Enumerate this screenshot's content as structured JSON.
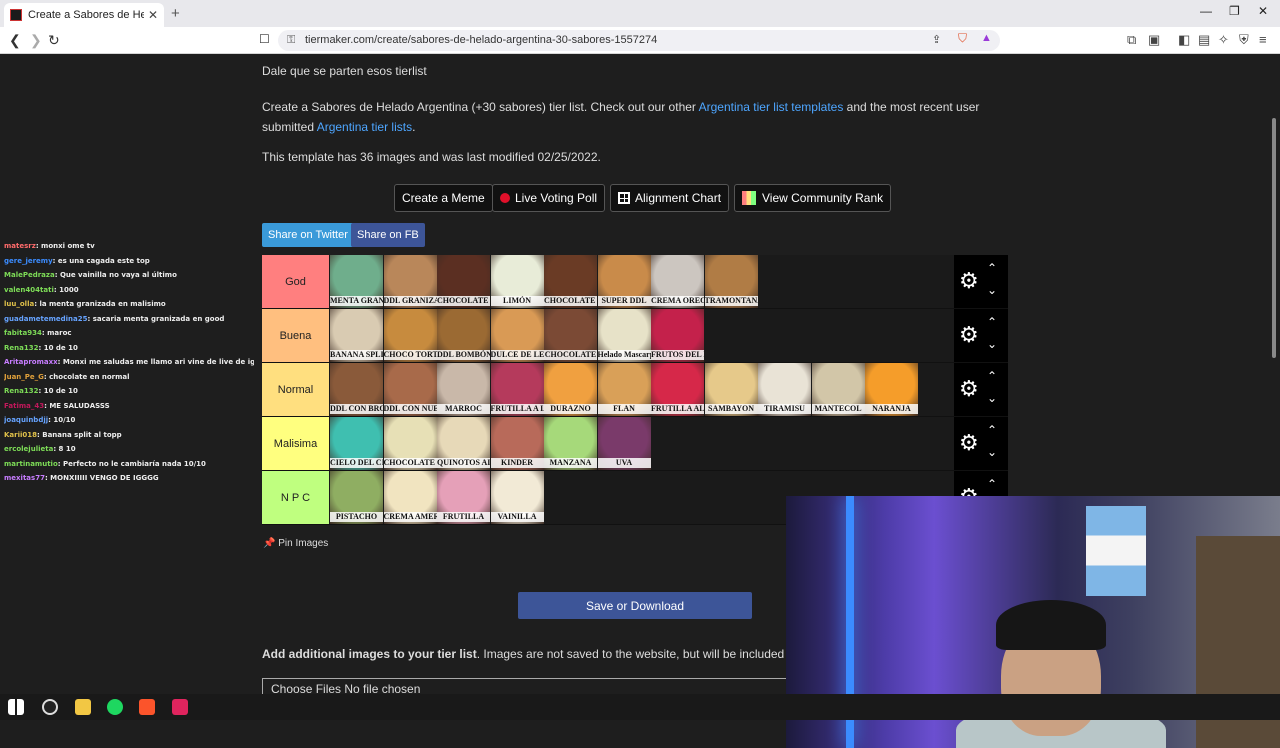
{
  "browser": {
    "tab_title": "Create a Sabores de Helado Argentina",
    "tab_close": "✕",
    "new_tab": "+",
    "url": "tiermaker.com/create/sabores-de-helado-argentina-30-sabores-1557274"
  },
  "page": {
    "intro": "Dale que se parten esos tierlist",
    "desc_prefix": "Create a Sabores de Helado Argentina (+30 sabores) tier list. Check out our other ",
    "desc_link1": "Argentina tier list templates",
    "desc_middle": " and the most recent user submitted ",
    "desc_link2": "Argentina tier lists",
    "desc_suffix": ".",
    "template_info": "This template has 36 images and was last modified 02/25/2022.",
    "buttons": {
      "meme": "Create a Meme",
      "voting": "Live Voting Poll",
      "alignment": "Alignment Chart",
      "community": "View Community Rank"
    },
    "share_twitter": "Share on Twitter",
    "share_fb": "Share on FB",
    "pin_images": "Pin Images",
    "save_download": "Save or Download",
    "add_images_bold": "Add additional images to your tier list",
    "add_images_rest": ". Images are not saved to the website, but will be included in you",
    "file_input": "Choose Files  No file chosen"
  },
  "tiers": [
    {
      "name": "God",
      "color": "#ff7f7f",
      "items": [
        {
          "label": "MENTA GRANIZADA",
          "color": "#6fae8c"
        },
        {
          "label": "DDL GRANIZADO",
          "color": "#b9875a"
        },
        {
          "label": "CHOCOLATE SUIZO",
          "color": "#5b2f22"
        },
        {
          "label": "LIMÓN",
          "color": "#e8ecd8"
        },
        {
          "label": "CHOCOLATE CON ALMENDRAS",
          "color": "#6a3b25"
        },
        {
          "label": "SUPER DDL",
          "color": "#c98b4a"
        },
        {
          "label": "CREMA OREO",
          "color": "#ccc6c0"
        },
        {
          "label": "TRAMONTANA",
          "color": "#b07c45"
        }
      ]
    },
    {
      "name": "Buena",
      "color": "#ffbf7f",
      "items": [
        {
          "label": "BANANA SPLIT",
          "color": "#d9cbb2"
        },
        {
          "label": "CHOCO TORTA",
          "color": "#c78b3e"
        },
        {
          "label": "DDL BOMBÓN",
          "color": "#9b6a33"
        },
        {
          "label": "DULCE DE LECHE",
          "color": "#d99a55"
        },
        {
          "label": "CHOCOLATE",
          "color": "#7b4a35"
        },
        {
          "label": "Helado Mascarpone",
          "color": "#e7e2c8"
        },
        {
          "label": "FRUTOS DEL BOSQUE",
          "color": "#c4214b"
        }
      ]
    },
    {
      "name": "Normal",
      "color": "#ffdf7f",
      "items": [
        {
          "label": "DDL CON BROWNIE",
          "color": "#8a5a3a"
        },
        {
          "label": "DDL CON NUEZ",
          "color": "#a86a4a"
        },
        {
          "label": "MARROC",
          "color": "#c9b8a9"
        },
        {
          "label": "FRUTILLA A LA REINA",
          "color": "#b53a5c"
        },
        {
          "label": "DURAZNO",
          "color": "#f0a040"
        },
        {
          "label": "FLAN",
          "color": "#d9a058"
        },
        {
          "label": "FRUTILLA AL AGUA",
          "color": "#d62849"
        },
        {
          "label": "SAMBAYON",
          "color": "#e6c98a"
        },
        {
          "label": "TIRAMISU",
          "color": "#e9e3d6"
        },
        {
          "label": "MANTECOL",
          "color": "#d2c6a8"
        },
        {
          "label": "NARANJA",
          "color": "#f59d2a"
        }
      ]
    },
    {
      "name": "Malisima",
      "color": "#ffff7f",
      "items": [
        {
          "label": "CIELO DEL CIELO",
          "color": "#3fbfb0"
        },
        {
          "label": "CHOCOLATE BLANCO",
          "color": "#e7e0b6"
        },
        {
          "label": "QUINOTOS AL WHISKY",
          "color": "#e7d9b8"
        },
        {
          "label": "KINDER",
          "color": "#b86a5a"
        },
        {
          "label": "MANZANA",
          "color": "#a6d97a"
        },
        {
          "label": "UVA",
          "color": "#7a3a6a"
        }
      ]
    },
    {
      "name": "N P C",
      "color": "#bfff7f",
      "items": [
        {
          "label": "PISTACHO",
          "color": "#8fae62"
        },
        {
          "label": "CREMA AMERICANA",
          "color": "#f1e4c0"
        },
        {
          "label": "FRUTILLA",
          "color": "#e5a0b8"
        },
        {
          "label": "VAINILLA",
          "color": "#f2ead6"
        }
      ]
    }
  ],
  "tier_controls": {
    "gear": "⚙",
    "up": "⌃",
    "down": "⌄"
  },
  "chat": [
    {
      "user": "matesrz",
      "msg": ": monxi ome tv",
      "color": "#ff6b6b"
    },
    {
      "user": "gere_jeremy",
      "msg": ": es una cagada este top",
      "color": "#3b8cff"
    },
    {
      "user": "MalePedraza",
      "msg": ": Que vainilla no vaya al último",
      "color": "#7ddc57"
    },
    {
      "user": "valen404tati",
      "msg": ": 1000",
      "color": "#7ddc57"
    },
    {
      "user": "luu_olla",
      "msg": ": la menta granizada en malisimo",
      "color": "#e0c14a"
    },
    {
      "user": "guadametemedina25",
      "msg": ": sacaria menta granizada en good",
      "color": "#66a3ff"
    },
    {
      "user": "fabita934",
      "msg": ": maroc",
      "color": "#7ddc57"
    },
    {
      "user": "Rena132",
      "msg": ": 10 de 10",
      "color": "#7ddc57"
    },
    {
      "user": "Aritapromaxx",
      "msg": ": Monxi me saludas me llamo ari vine de live de ig",
      "color": "#c77dff"
    },
    {
      "user": "Juan_Pe_G",
      "msg": ": chocolate en normal",
      "color": "#e0a03a"
    },
    {
      "user": "Rena132",
      "msg": ": 10 de 10",
      "color": "#7ddc57"
    },
    {
      "user": "Fatima_43",
      "msg": ": ME SALUDASSS",
      "color": "#c2185b"
    },
    {
      "user": "joaquinbdjj",
      "msg": ": 10/10",
      "color": "#66a3ff"
    },
    {
      "user": "Karii018",
      "msg": ": Banana split al topp",
      "color": "#e0c14a"
    },
    {
      "user": "ercolejulieta",
      "msg": ": 8 10",
      "color": "#7ddc57"
    },
    {
      "user": "martinamutio",
      "msg": ": Perfecto no le cambiaría nada 10/10",
      "color": "#7ddc57"
    },
    {
      "user": "mexitas77",
      "msg": ": MONXIIIII VENGO DE IGGGG",
      "color": "#c77dff"
    }
  ]
}
